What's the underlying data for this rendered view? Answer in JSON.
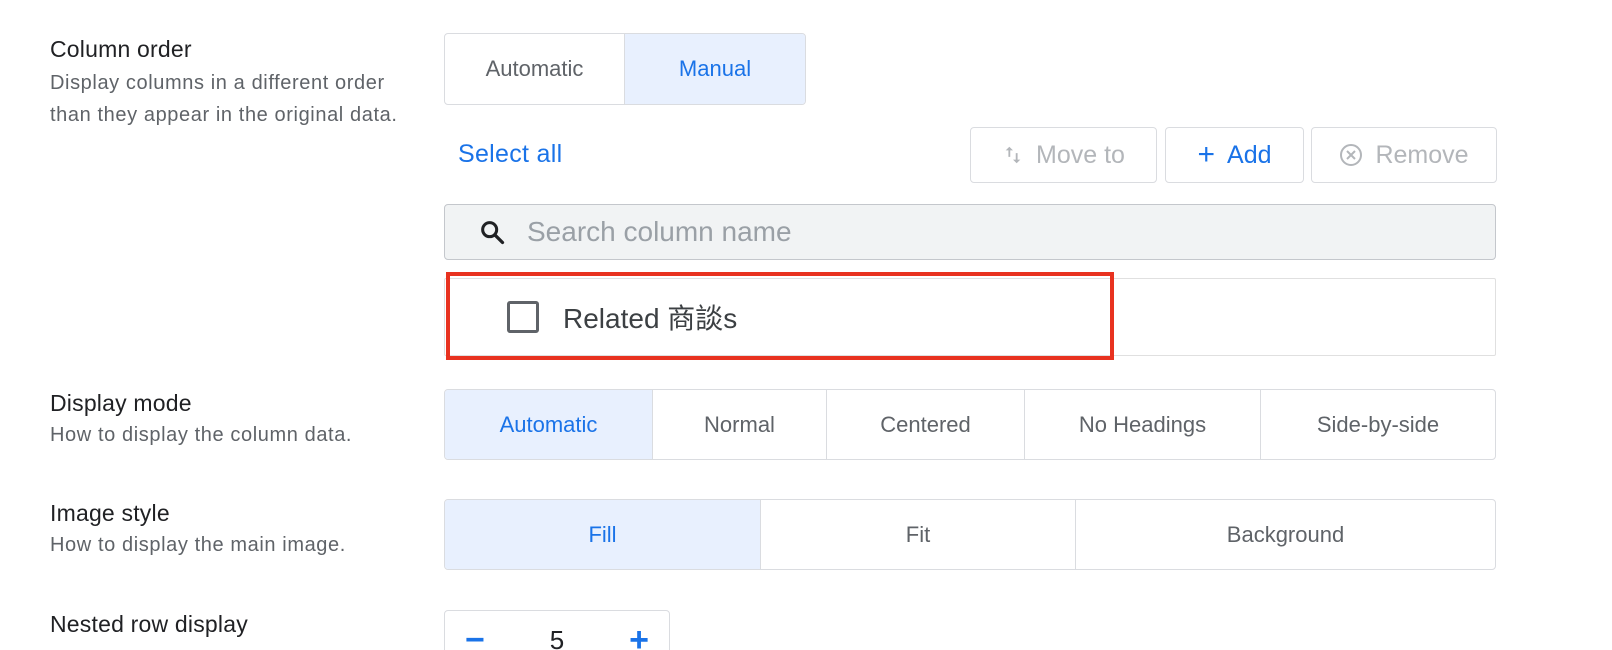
{
  "column_order": {
    "title": "Column order",
    "description": "Display columns in a different order than they appear in the original data.",
    "options": [
      "Automatic",
      "Manual"
    ],
    "selected": "Manual",
    "select_all": "Select all",
    "move_to": "Move to",
    "add": "Add",
    "remove": "Remove",
    "search_placeholder": "Search column name",
    "items": [
      {
        "label": "Related 商談s",
        "checked": false
      }
    ]
  },
  "display_mode": {
    "title": "Display mode",
    "description": "How to display the column data.",
    "options": [
      "Automatic",
      "Normal",
      "Centered",
      "No Headings",
      "Side-by-side"
    ],
    "selected": "Automatic"
  },
  "image_style": {
    "title": "Image style",
    "description": "How to display the main image.",
    "options": [
      "Fill",
      "Fit",
      "Background"
    ],
    "selected": "Fill"
  },
  "nested_row_display": {
    "title": "Nested row display",
    "minus": "−",
    "value": "5",
    "plus": "+"
  },
  "colors": {
    "accent": "#1a73e8",
    "selected_bg": "#e8f0fe",
    "highlight": "#e8321f"
  }
}
